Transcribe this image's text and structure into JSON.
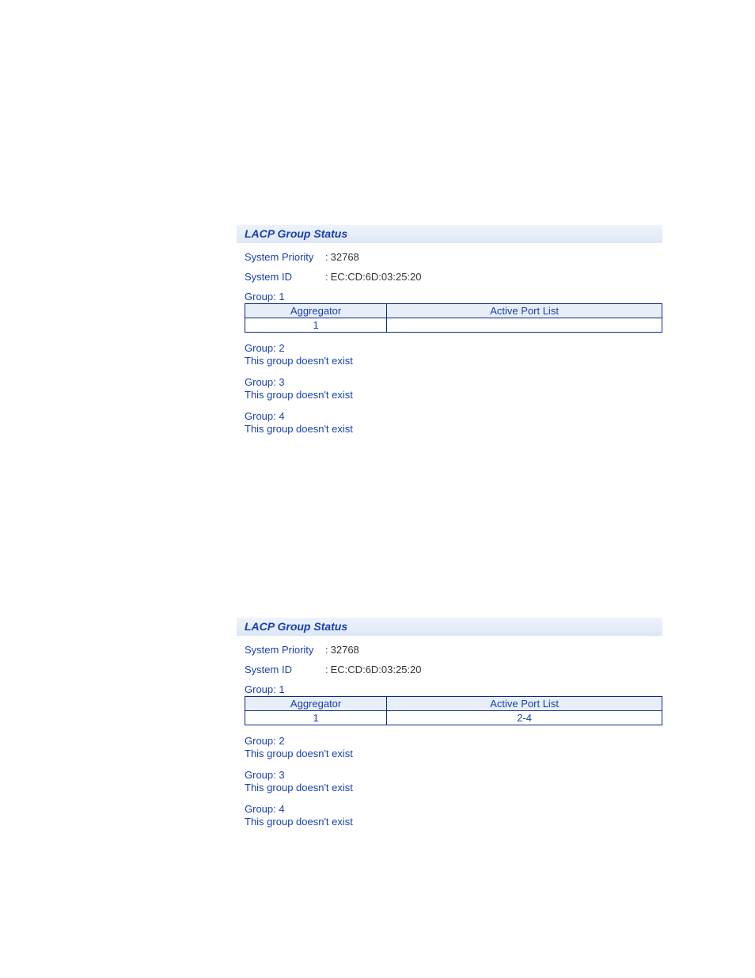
{
  "panels": [
    {
      "title": "LACP Group Status",
      "system_priority_label": "System Priority",
      "system_priority_value": "32768",
      "system_id_label": "System ID",
      "system_id_value": "EC:CD:6D:03:25:20",
      "group1_label": "Group: 1",
      "table": {
        "header_aggregator": "Aggregator",
        "header_active_port_list": "Active Port List",
        "aggregator_value": "1",
        "active_port_list_value": ""
      },
      "group2_label": "Group: 2",
      "group2_msg": "This group doesn't exist",
      "group3_label": "Group: 3",
      "group3_msg": "This group doesn't exist",
      "group4_label": "Group: 4",
      "group4_msg": "This group doesn't exist"
    },
    {
      "title": "LACP Group Status",
      "system_priority_label": "System Priority",
      "system_priority_value": "32768",
      "system_id_label": "System ID",
      "system_id_value": "EC:CD:6D:03:25:20",
      "group1_label": "Group: 1",
      "table": {
        "header_aggregator": "Aggregator",
        "header_active_port_list": "Active Port List",
        "aggregator_value": "1",
        "active_port_list_value": "2-4"
      },
      "group2_label": "Group: 2",
      "group2_msg": "This group doesn't exist",
      "group3_label": "Group: 3",
      "group3_msg": "This group doesn't exist",
      "group4_label": "Group: 4",
      "group4_msg": "This group doesn't exist"
    }
  ]
}
